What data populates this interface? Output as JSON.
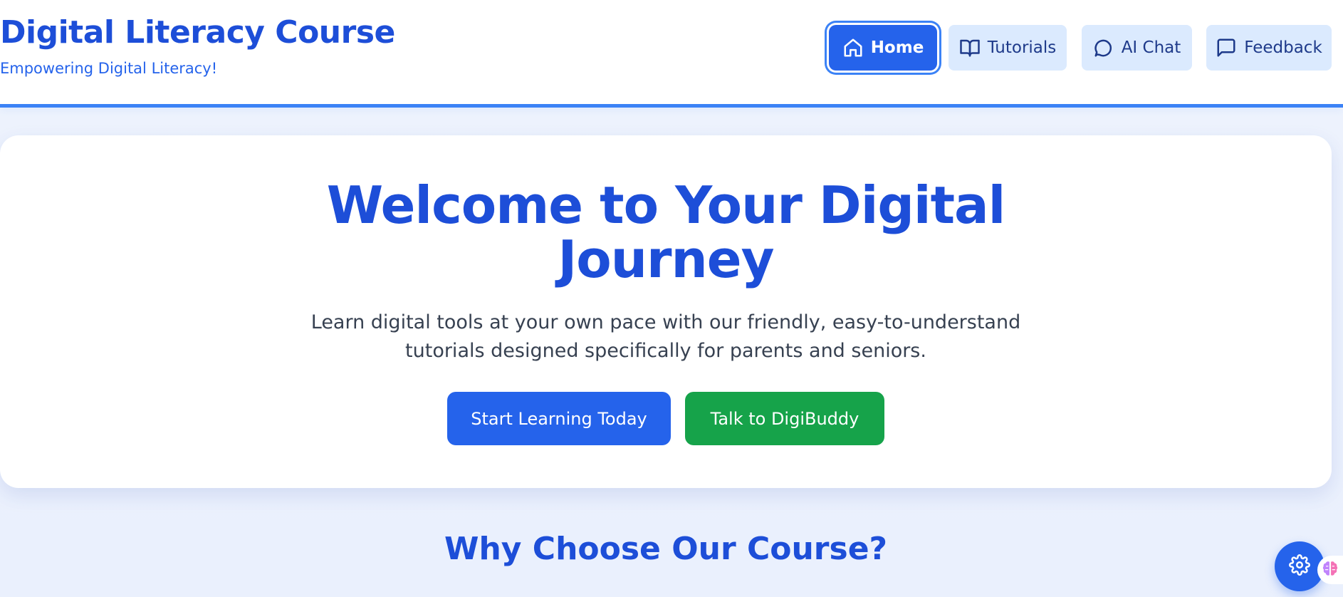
{
  "header": {
    "title": "Digital Literacy Course",
    "subtitle": "Empowering Digital Literacy!",
    "nav": [
      {
        "label": "Home",
        "icon": "home-icon",
        "active": true
      },
      {
        "label": "Tutorials",
        "icon": "book-icon",
        "active": false
      },
      {
        "label": "AI Chat",
        "icon": "chat-bubble-icon",
        "active": false
      },
      {
        "label": "Feedback",
        "icon": "message-square-icon",
        "active": false
      }
    ]
  },
  "hero": {
    "title": "Welcome to Your Digital Journey",
    "description": "Learn digital tools at your own pace with our friendly, easy-to-understand tutorials designed specifically for parents and seniors.",
    "primary_cta": "Start Learning Today",
    "secondary_cta": "Talk to DigiBuddy"
  },
  "features": {
    "title": "Why Choose Our Course?"
  },
  "floating": {
    "settings_icon": "gear-icon",
    "assistant_icon": "brain-icon"
  },
  "colors": {
    "primary": "#2563eb",
    "heading": "#1d4ed8",
    "success": "#16a34a",
    "nav_bg": "#dbeafe",
    "accent_border": "#3b82f6"
  }
}
